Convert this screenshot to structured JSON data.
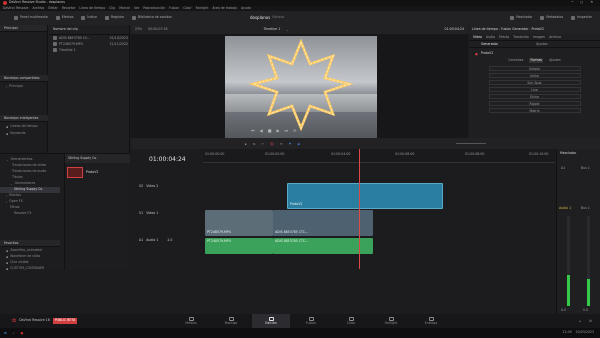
{
  "window": {
    "title": "DaVinci Resolve Studio - dosplanos"
  },
  "menu": [
    "DaVinci Resolve",
    "Archivo",
    "Editar",
    "Recortar",
    "Línea de tiempo",
    "Clip",
    "Marcar",
    "Ver",
    "Reproducción",
    "Fusion",
    "Color",
    "Fairlight",
    "Área de trabajo",
    "Ayuda"
  ],
  "toolbar": {
    "left": [
      "Panel multimedia",
      "Efectos",
      "Índice",
      "Registro",
      "Biblioteca de sonidos"
    ],
    "project": "dosplanos",
    "project_state": "Editado",
    "right": [
      "Mezclador",
      "Metadatos",
      "Inspector"
    ]
  },
  "viewer": {
    "zoom": "23%",
    "source_tc": "00:00:07:16",
    "timeline_name": "Timeline 1",
    "tc": "01:00:04:24"
  },
  "mediapool": {
    "section_main": "Principal",
    "col_header": "Nombre del clip",
    "clips": [
      {
        "name": "ADIS 8853785 Cli...",
        "date": "01/10/2023"
      },
      {
        "name": "PT248579.MP4",
        "date": "21/11/2022"
      },
      {
        "name": "Timeline 1",
        "date": ""
      }
    ],
    "shared": "Bandejas compartidas",
    "shared_item": "Principal",
    "smart": "Bandejas inteligentes",
    "smart_items": [
      "Líneas de tiempo",
      "Keywords"
    ]
  },
  "inspector": {
    "title": "Línea de tiempo - Fusion Generator - ProtoV2",
    "tabs": [
      "Vídeo",
      "Audio",
      "Efecto",
      "Transición",
      "Imagen",
      "Archivo"
    ],
    "subtab": "Generador",
    "subtab2": "Ajustes",
    "node": "ProtoV2",
    "node_tabs": [
      "Controles",
      "Formas",
      "Ajustes"
    ],
    "params": [
      "Simple",
      "Inline",
      "Sun Spot",
      "Line",
      "Shine",
      "Ripple",
      "Matrix"
    ]
  },
  "effects": {
    "items": [
      "Herramientas",
      "Transiciones de vídeo",
      "Transiciones de audio",
      "Títulos",
      "Generadores"
    ],
    "sub": [
      "Efectos",
      "Open FX",
      "Filtros",
      "Resolve FX"
    ],
    "selected": "Stirling Supply Co",
    "fav_header": "Favoritos",
    "favorites": [
      "Zoomflex_animated",
      "Waveform de sillas",
      "Cine visible",
      "CUSTOM_CONTAINER"
    ],
    "grid_header": "Stirling Supply Co",
    "tile": "ProtoV2"
  },
  "timeline": {
    "tc": "01:00:04:24",
    "ruler": [
      "01:00:00:00",
      "01:00:02:00",
      "01:00:04:00",
      "01:00:06:00",
      "01:00:08:00",
      "01:00:10:00"
    ],
    "tracks": [
      {
        "id": "V2",
        "name": "Vídeo 2"
      },
      {
        "id": "V1",
        "name": "Vídeo 1"
      },
      {
        "id": "A1",
        "name": "Audio 1",
        "level": "2.0"
      }
    ],
    "clips": [
      {
        "label": "ProtoV2",
        "track": "V2"
      },
      {
        "label": "PT248579.MP4",
        "track": "V1"
      },
      {
        "label": "ADIS 8853785 CTC...",
        "track": "V1"
      },
      {
        "label": "PT248579.MP4",
        "track": "A1"
      },
      {
        "label": "ADIS 8853785 CTC...",
        "track": "A1"
      }
    ]
  },
  "mixer": {
    "title": "Mezclador",
    "ch1": "A1",
    "ch2": "Bus 1",
    "ch1_label": "Audio 1",
    "ch2_label": "Bus 1",
    "db1": "0.0",
    "db2": "0.0",
    "level1": 0.35,
    "level2": 0.3
  },
  "pages": [
    "Medios",
    "Montaje",
    "Edición",
    "Fusion",
    "Color",
    "Fairlight",
    "Entrega"
  ],
  "active_page": "Edición",
  "brand": {
    "name": "DaVinci Resolve 18",
    "badge": "PUBLIC BETA"
  },
  "colors": {
    "video_clip": "#2a7fa0",
    "audio_clip": "#3aa25a",
    "playhead": "#e04848",
    "accent": "#d04040"
  },
  "taskbar": {
    "time": "11:09",
    "date": "20/03/2023"
  }
}
